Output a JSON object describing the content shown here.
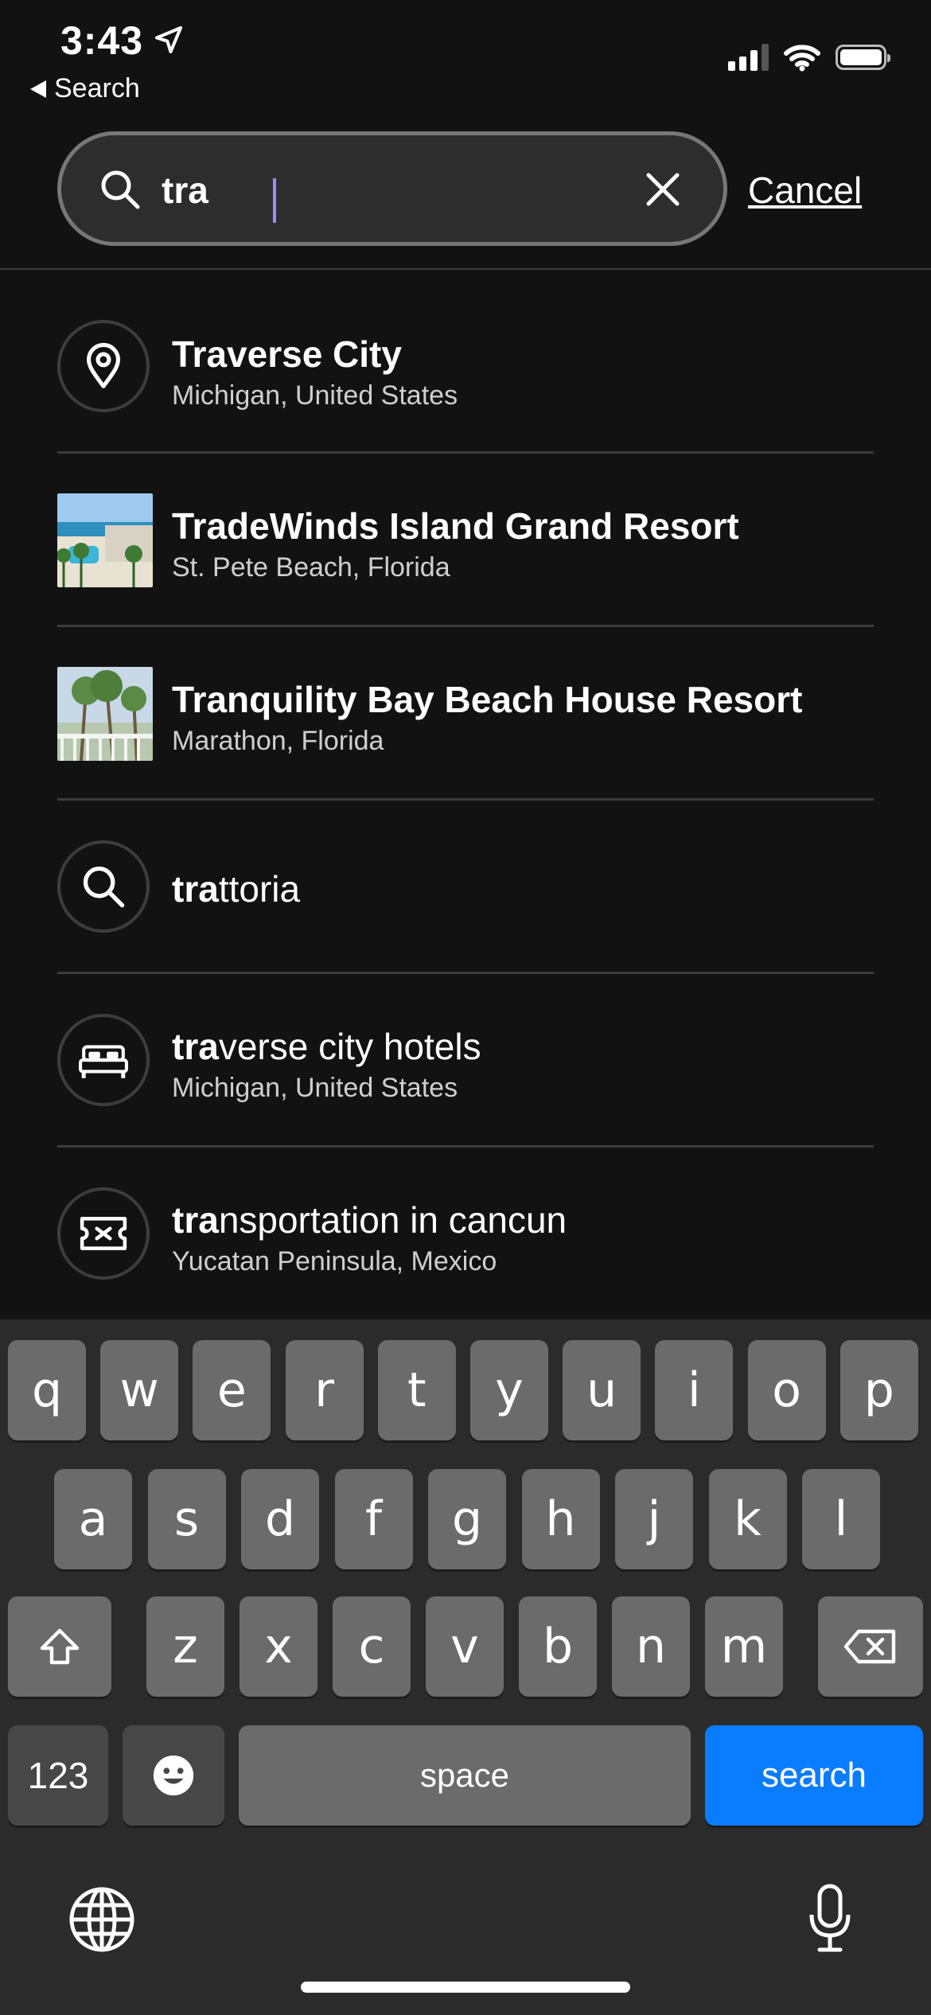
{
  "status_bar": {
    "time": "3:43",
    "back_app": "Search"
  },
  "search": {
    "value": "tra",
    "cancel_label": "Cancel"
  },
  "results": [
    {
      "type": "location",
      "icon": "map-pin-icon",
      "bold": "Traverse City",
      "rest": "",
      "subtitle": "Michigan, United States"
    },
    {
      "type": "hotel",
      "icon": "hotel-photo",
      "bold": "TradeWinds Island Grand Resort",
      "rest": "",
      "subtitle": "St. Pete Beach, Florida"
    },
    {
      "type": "hotel",
      "icon": "hotel-photo",
      "bold": "Tranquility Bay Beach House Resort",
      "rest": "",
      "subtitle": "Marathon, Florida"
    },
    {
      "type": "search",
      "icon": "search-icon",
      "bold": "tra",
      "rest": "ttoria",
      "subtitle": ""
    },
    {
      "type": "hotels",
      "icon": "bed-icon",
      "bold": "tra",
      "rest": "verse city hotels",
      "subtitle": "Michigan, United States"
    },
    {
      "type": "things-to-do",
      "icon": "ticket-icon",
      "bold": "tra",
      "rest": "nsportation in cancun",
      "subtitle": "Yucatan Peninsula, Mexico"
    }
  ],
  "keyboard": {
    "row1": [
      "q",
      "w",
      "e",
      "r",
      "t",
      "y",
      "u",
      "i",
      "o",
      "p"
    ],
    "row2": [
      "a",
      "s",
      "d",
      "f",
      "g",
      "h",
      "j",
      "k",
      "l"
    ],
    "row3": [
      "z",
      "x",
      "c",
      "v",
      "b",
      "n",
      "m"
    ],
    "numbers_label": "123",
    "space_label": "space",
    "search_label": "search"
  },
  "colors": {
    "background": "#121212",
    "accent": "#0a7cff",
    "caret": "#9a8cff"
  }
}
